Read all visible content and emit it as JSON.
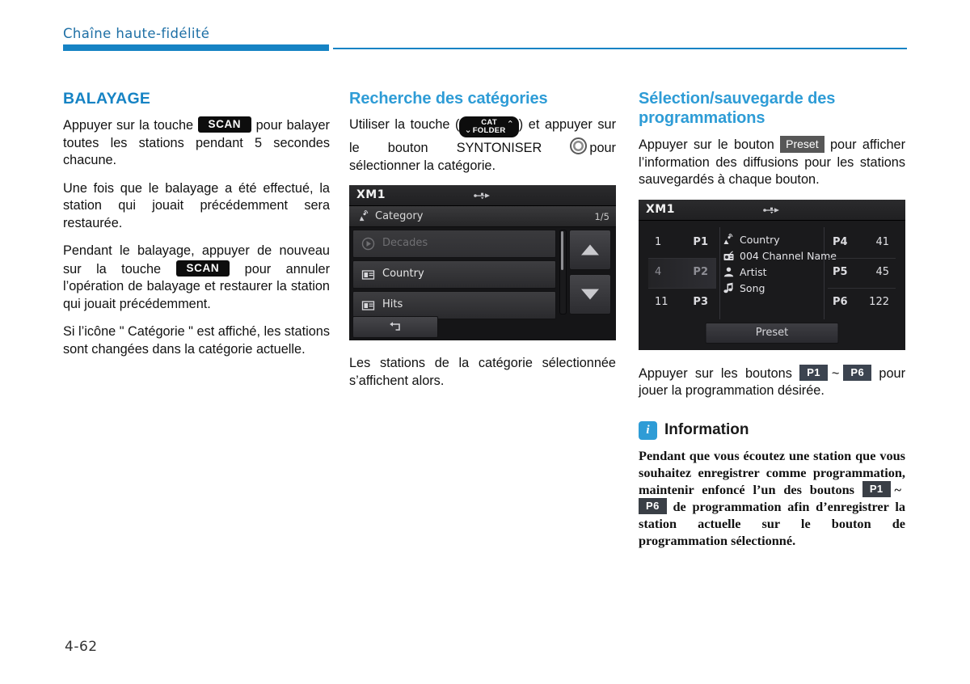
{
  "header": {
    "chapter_title": "Chaîne haute-fidélité"
  },
  "page_number": "4-62",
  "col1": {
    "heading": "BALAYAGE",
    "p1_a": "Appuyer sur la touche",
    "p1_key": "SCAN",
    "p1_b": "pour balayer toutes les stations pendant 5 secondes chacune.",
    "p2": "Une fois que le balayage a été effectué, la station qui jouait précédemment sera restaurée.",
    "p3_a": "Pendant le balayage, appuyer de nouveau sur la touche",
    "p3_key": "SCAN",
    "p3_b": "pour annuler l’opération de balayage et restaurer la station qui jouait précédemment.",
    "p4": "Si l’icône \" Catégorie \" est affiché, les stations sont changées dans la catégorie actuelle."
  },
  "col2": {
    "heading": "Recherche des catégories",
    "p1_a": "Utiliser la touche (",
    "key_cat": "CAT",
    "key_folder": "FOLDER",
    "chevron_down": "⌄",
    "chevron_up": "⌃",
    "p1_b": ") et appuyer sur le bouton SYNTONISER",
    "p1_c": "pour sélectionner la catégorie.",
    "caption": "Les stations de la catégorie sélectionnée s’affichent alors."
  },
  "device_category": {
    "title": "XM1",
    "usb_icon": "usb-icon",
    "satellite_icon": "satellite-dish-icon",
    "category_label": "Category",
    "pager": "1/5",
    "rows": [
      {
        "label": "Decades",
        "icon": "play-circle-icon",
        "state": "dim"
      },
      {
        "label": "Country",
        "icon": "folder-note-icon",
        "state": "normal"
      },
      {
        "label": "Hits",
        "icon": "folder-note-icon",
        "state": "normal"
      }
    ],
    "up_arrow_icon": "triangle-up-icon",
    "down_arrow_icon": "triangle-down-icon",
    "back_icon": "back-arrow-icon"
  },
  "col3": {
    "heading": "Sélection/sauvegarde des programmations",
    "p1_a": "Appuyer sur le bouton",
    "p1_key": "Preset",
    "p1_b": "pour afficher l’information des diffusions pour les stations sauvegardés à chaque bouton.",
    "caption_a": "Appuyer sur les boutons",
    "caption_key1": "P1",
    "caption_tilde": "~",
    "caption_key2": "P6",
    "caption_b": "pour jouer la programmation désirée.",
    "info_title": "Information",
    "info_badge": "i",
    "info_a": "Pendant que vous écoutez une station que vous souhaitez enregistrer comme programmation, maintenir enfoncé l’un des boutons",
    "info_key1": "P1",
    "info_tilde": "~",
    "info_key2": "P6",
    "info_b": "de programmation afin d’enregistrer la station actuelle sur le bouton de programmation sélectionné."
  },
  "device_preset": {
    "title": "XM1",
    "usb_icon": "usb-icon",
    "left_cells": [
      {
        "num": "1",
        "label": "P1",
        "state": "normal"
      },
      {
        "num": "4",
        "label": "P2",
        "state": "highlight"
      },
      {
        "num": "11",
        "label": "P3",
        "state": "normal"
      }
    ],
    "right_cells": [
      {
        "label": "P4",
        "num": "41",
        "state": "normal"
      },
      {
        "label": "P5",
        "num": "45",
        "state": "normal"
      },
      {
        "label": "P6",
        "num": "122",
        "state": "normal"
      }
    ],
    "info_rows": [
      {
        "icon": "satellite-dish-icon",
        "text": "Country"
      },
      {
        "icon": "radio-icon",
        "text": "004 Channel Name"
      },
      {
        "icon": "person-icon",
        "text": "Artist"
      },
      {
        "icon": "music-note-icon",
        "text": "Song"
      }
    ],
    "preset_button": "Preset"
  },
  "colors": {
    "accent_blue": "#2e9cd6",
    "rule_blue": "#1683c4",
    "header_blue": "#1d6fa5",
    "key_black": "#0d0d0d",
    "key_gray": "#575757",
    "key_slate": "#3c4450"
  }
}
